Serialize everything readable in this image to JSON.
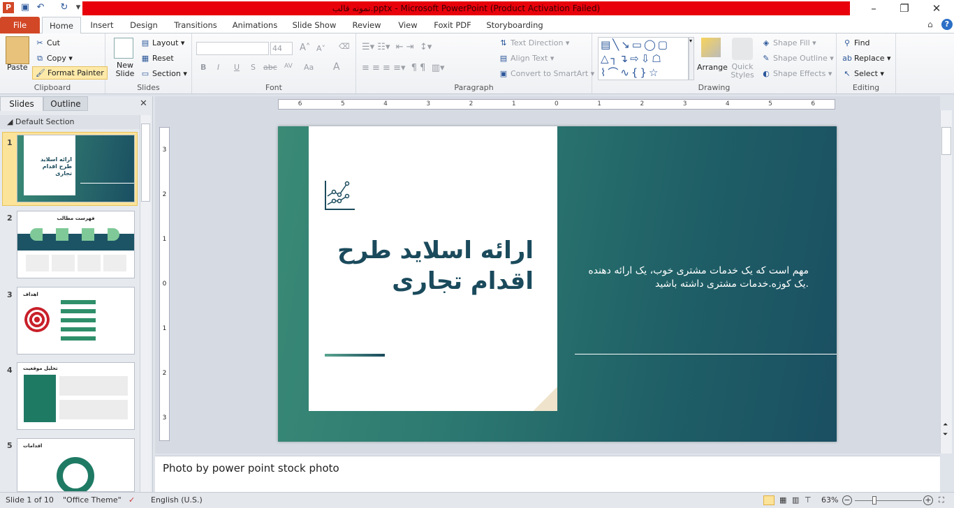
{
  "window": {
    "title": "نمونه قالب.pptx - Microsoft PowerPoint (Product Activation Failed)",
    "app_icon": "P",
    "accent": "#d24726",
    "title_bar_color": "#e8000b"
  },
  "tabs": [
    "File",
    "Home",
    "Insert",
    "Design",
    "Transitions",
    "Animations",
    "Slide Show",
    "Review",
    "View",
    "Foxit PDF",
    "Storyboarding"
  ],
  "ribbon": {
    "clipboard": {
      "label": "Clipboard",
      "paste": "Paste",
      "cut": "Cut",
      "copy": "Copy",
      "format_painter": "Format Painter"
    },
    "slides": {
      "label": "Slides",
      "new_slide": "New Slide",
      "layout": "Layout",
      "reset": "Reset",
      "section": "Section"
    },
    "font": {
      "label": "Font",
      "font_name": "",
      "font_size": "44",
      "bold": "B",
      "italic": "I",
      "underline": "U",
      "shadow": "S",
      "strike": "abc",
      "spacing": "AV",
      "case": "Aa",
      "color": "A"
    },
    "paragraph": {
      "label": "Paragraph",
      "text_direction": "Text Direction",
      "align_text": "Align Text",
      "smartart": "Convert to SmartArt"
    },
    "drawing": {
      "label": "Drawing",
      "arrange": "Arrange",
      "quick_styles": "Quick Styles",
      "shape_fill": "Shape Fill",
      "shape_outline": "Shape Outline",
      "shape_effects": "Shape Effects"
    },
    "editing": {
      "label": "Editing",
      "find": "Find",
      "replace": "Replace",
      "select": "Select"
    }
  },
  "left_pane": {
    "tabs": [
      "Slides",
      "Outline"
    ],
    "section": "Default Section",
    "thumbnails": [
      {
        "num": "1",
        "title": "ارائه اسلاید طرح اقدام تجاری"
      },
      {
        "num": "2",
        "title": "فهرست مطالب"
      },
      {
        "num": "3",
        "title": "اهداف"
      },
      {
        "num": "4",
        "title": "تحلیل موقعیت"
      },
      {
        "num": "5",
        "title": "اقدامات"
      }
    ]
  },
  "ruler": {
    "h": [
      "6",
      "5",
      "4",
      "3",
      "2",
      "1",
      "0",
      "1",
      "2",
      "3",
      "4",
      "5",
      "6"
    ],
    "v": [
      "3",
      "2",
      "1",
      "0",
      "1",
      "2",
      "3"
    ]
  },
  "slide": {
    "title_line1": "ارائه اسلاید طرح",
    "title_line2": "اقدام تجاری",
    "body_line1": "مهم است که یک خدمات مشتری خوب، یک ارائه دهنده",
    "body_line2": ".یک کوزه.خدمات مشتری داشته باشید",
    "title_color": "#1a4a5c"
  },
  "notes": "Photo by power point stock photo",
  "status": {
    "slide": "Slide 1 of 10",
    "theme": "\"Office Theme\"",
    "language": "English (U.S.)",
    "zoom": "63%",
    "zoom_value": 63
  }
}
